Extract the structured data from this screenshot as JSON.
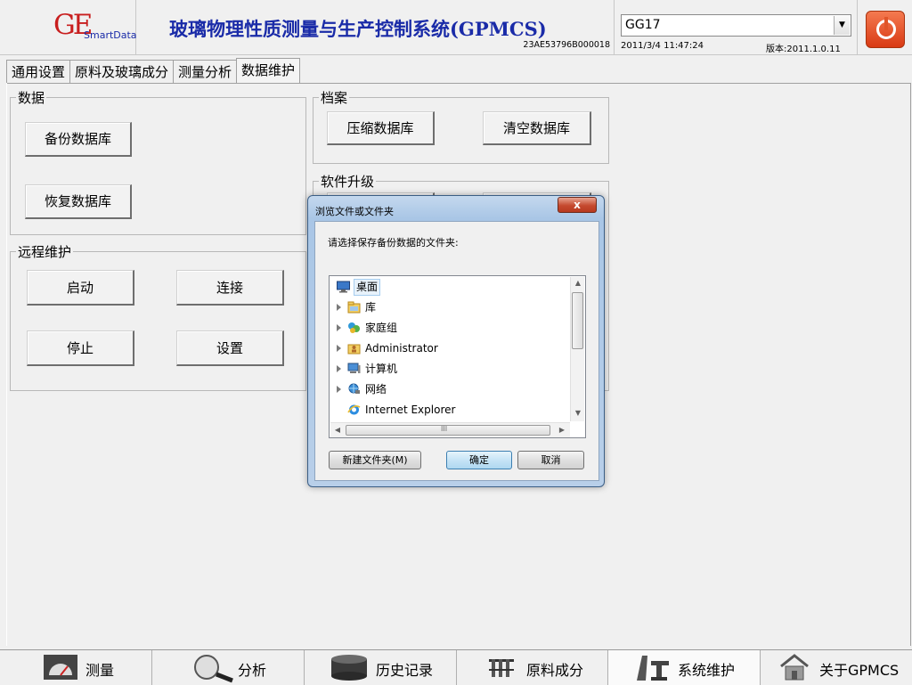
{
  "header": {
    "logo_ge": "GE",
    "logo_smart": "SmartData",
    "title": "玻璃物理性质测量与生产控制系统(GPMCS)",
    "serial": "23AE53796B000018",
    "combo_value": "GG17",
    "datetime": "2011/3/4 11:47:24",
    "version": "版本:2011.1.0.11"
  },
  "tabs": [
    {
      "label": "通用设置"
    },
    {
      "label": "原料及玻璃成分"
    },
    {
      "label": "测量分析"
    },
    {
      "label": "数据维护"
    }
  ],
  "groups": {
    "data": {
      "title": "数据",
      "backup": "备份数据库",
      "restore": "恢复数据库"
    },
    "archive": {
      "title": "档案",
      "compress": "压缩数据库",
      "clear": "清空数据库"
    },
    "upgrade": {
      "title": "软件升级"
    },
    "remote": {
      "title": "远程维护",
      "start": "启动",
      "connect": "连接",
      "stop": "停止",
      "settings": "设置"
    }
  },
  "dialog": {
    "title": "浏览文件或文件夹",
    "close": "x",
    "prompt": "请选择保存备份数据的文件夹:",
    "tree": [
      {
        "label": "桌面"
      },
      {
        "label": "库"
      },
      {
        "label": "家庭组"
      },
      {
        "label": "Administrator"
      },
      {
        "label": "计算机"
      },
      {
        "label": "网络"
      },
      {
        "label": "Internet Explorer"
      }
    ],
    "hscroll_grip": "III",
    "new_folder": "新建文件夹(M)",
    "ok": "确定",
    "cancel": "取消"
  },
  "bottom_nav": [
    {
      "label": "测量"
    },
    {
      "label": "分析"
    },
    {
      "label": "历史记录"
    },
    {
      "label": "原料成分"
    },
    {
      "label": "系统维护"
    },
    {
      "label": "关于GPMCS"
    }
  ]
}
